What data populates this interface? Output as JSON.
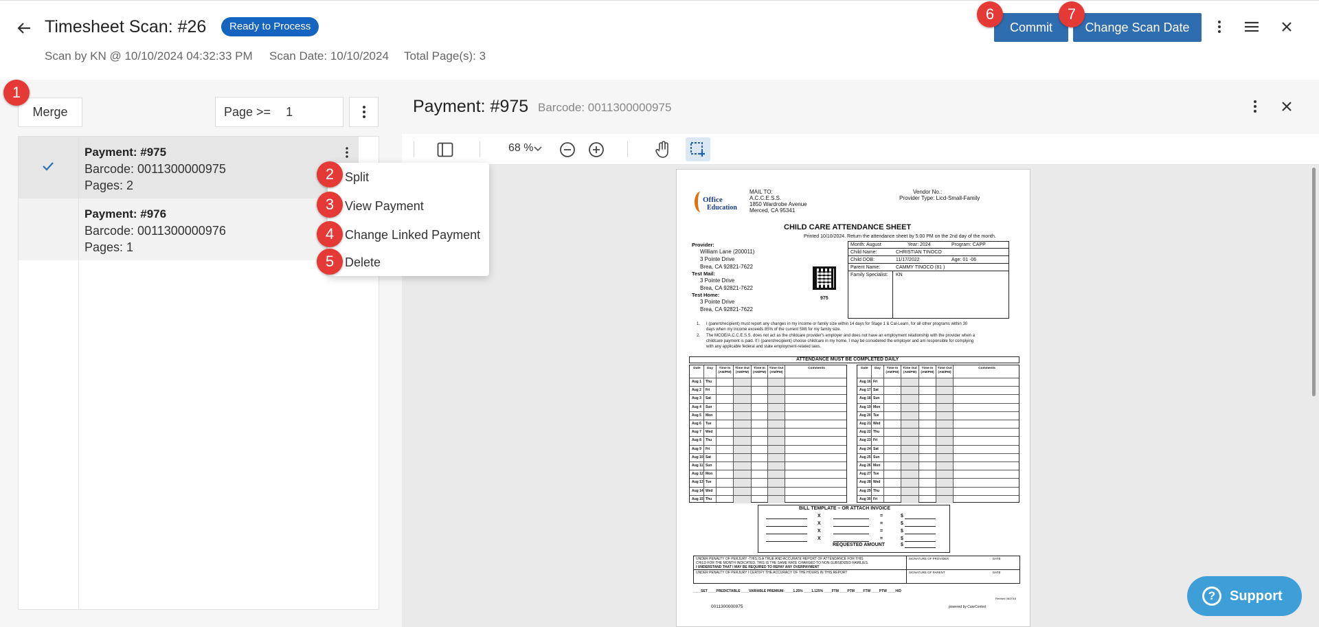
{
  "header": {
    "title": "Timesheet Scan: #26",
    "status": "Ready to Process",
    "scan_by": "Scan by KN @ 10/10/2024 04:32:33 PM",
    "scan_date": "Scan Date: 10/10/2024",
    "total_pages": "Total Page(s): 3",
    "commit_label": "Commit",
    "change_scan_date_label": "Change Scan Date"
  },
  "steps": [
    "1",
    "2",
    "3",
    "4",
    "5",
    "6",
    "7"
  ],
  "left": {
    "merge_label": "Merge",
    "filter_label": "Page >=",
    "filter_value": "1",
    "items": [
      {
        "title": "Payment: #975",
        "barcode": "Barcode: 0011300000975",
        "pages": "Pages: 2",
        "selected": true
      },
      {
        "title": "Payment: #976",
        "barcode": "Barcode: 0011300000976",
        "pages": "Pages: 1",
        "selected": false
      }
    ]
  },
  "context_menu": {
    "items": [
      "Split",
      "View Payment",
      "Change Linked Payment",
      "Delete"
    ]
  },
  "right": {
    "title": "Payment: #975",
    "barcode": "Barcode: 0011300000975",
    "zoom": "68 %"
  },
  "doc": {
    "mail_to": "MAIL TO:",
    "org": "A.C.C.E.S.S.",
    "addr1": "1850 Wardrobe Avenue",
    "addr2": "Merced, CA 95341",
    "vendor_no": "Vendor No.:",
    "provider_type": "Provider Type:  Licd-Small-Family",
    "logo_line1": "Office",
    "logo_line2": "Education",
    "sheet_title": "CHILD CARE ATTENDANCE SHEET",
    "printed": "Printed 10/10/2024. Return the attendance sheet by 5:00 PM on the 2nd day of the month.",
    "provider_lbl": "Provider:",
    "provider_name": "William Lane (200011)",
    "provider_addr1": "3 Pointe Drive",
    "provider_addr2": "Brea, CA 92821-7622",
    "test_mail_lbl": "Test Mail:",
    "test_mail_addr1": "3 Pointe Drive",
    "test_mail_addr2": "Brea, CA 92821-7622",
    "test_home_lbl": "Test Home:",
    "test_home_addr1": "3 Pointe Drive",
    "test_home_addr2": "Brea, CA 92821-7622",
    "qr_number": "975",
    "month": "Month: August",
    "year": "Year: 2024",
    "program": "Program: CAPP",
    "child_name_lbl": "Child Name:",
    "child_name": "CHRISTIAN  TINOCO",
    "child_dob_lbl": "Child DOB:",
    "child_dob": "11/17/2022",
    "age": "Age: 01 -06",
    "parent_lbl": "Parent Name:",
    "parent": "CAMMY  TINOCO (81 )",
    "specialist_lbl": "Family Specialist:",
    "specialist": "KN",
    "note1": "I (parent/recipient) must report any changes in my income or family size within 14 days for Stage 1 & Cal-Learn, for all other programs within 30",
    "note1b": "days when my income exceeds 85% of the current SMI for my family size.",
    "note2": "The MCOE/A.C.C.E.S.S. does not act as the childcare provider's employer and does not have an employment relationship with the provider when a",
    "note2b": "childcare payment is paid. If I (parent/recipient) choose childcare in my home, I may be considered the employer and am responsible for complying",
    "note2c": "with any applicable federal and state employment-related laws.",
    "attendance_header": "ATTENDANCE MUST BE COMPLETED DAILY",
    "col_headers": [
      "Date",
      "Day",
      "Time In (AM/PM)",
      "Time Out (AM/PM)",
      "Time In (AM/PM)",
      "Time Out (AM/PM)",
      "Comments"
    ],
    "left_rows": [
      [
        "Aug 1",
        "Thu"
      ],
      [
        "Aug 2",
        "Fri"
      ],
      [
        "Aug 3",
        "Sat"
      ],
      [
        "Aug 4",
        "Sun"
      ],
      [
        "Aug 5",
        "Mon"
      ],
      [
        "Aug 6",
        "Tue"
      ],
      [
        "Aug 7",
        "Wed"
      ],
      [
        "Aug 8",
        "Thu"
      ],
      [
        "Aug 9",
        "Fri"
      ],
      [
        "Aug 10",
        "Sat"
      ],
      [
        "Aug 11",
        "Sun"
      ],
      [
        "Aug 12",
        "Mon"
      ],
      [
        "Aug 13",
        "Tue"
      ],
      [
        "Aug 14",
        "Wed"
      ],
      [
        "Aug 15",
        "Thu"
      ]
    ],
    "right_rows": [
      [
        "Aug 16",
        "Fri"
      ],
      [
        "Aug 17",
        "Sat"
      ],
      [
        "Aug 18",
        "Sun"
      ],
      [
        "Aug 19",
        "Mon"
      ],
      [
        "Aug 20",
        "Tue"
      ],
      [
        "Aug 21",
        "Wed"
      ],
      [
        "Aug 22",
        "Thu"
      ],
      [
        "Aug 23",
        "Fri"
      ],
      [
        "Aug 24",
        "Sat"
      ],
      [
        "Aug 25",
        "Sun"
      ],
      [
        "Aug 26",
        "Mon"
      ],
      [
        "Aug 27",
        "Tue"
      ],
      [
        "Aug 28",
        "Wed"
      ],
      [
        "Aug 29",
        "Thu"
      ],
      [
        "Aug 30",
        "Fri"
      ]
    ],
    "bill_header": "BILL TEMPLATE – OR ATTACH INVOICE",
    "bill_x": "X",
    "bill_eq": "=",
    "bill_dollar": "$",
    "requested_amount": "REQUESTED AMOUNT",
    "perjury1": "UNDER PENALTY OF PERJURY -THIS IS A TRUE AND ACCURATE REPORT OF ATTENDANCE FOR THIS",
    "perjury2": "CHILD FOR THE MONTH INDICATED. THIS IS THE SAME RATE CHARGED TO NON-SUBSIDIZED FAMILIES.",
    "perjury3": "I UNDERSTAND THAT I MAY BE REQUIRED TO REPAY ANY OVERPAYMENT",
    "perjury4": "UNDER PENALTY OF PERJURY I CERTIFY THE ACCURACY OF THE HOURS IN THIS REPORT",
    "sig_provider": "SIGNATURE OF PROVIDER",
    "sig_parent": "SIGNATURE OF PARENT",
    "date_lbl": "DATE",
    "footer_opts": "____SET   ____PREDICTABLE   ____VARIABLE    PREMIUM:  ____1.25%   ____1.125%       ____FTM   ____PTM   ____FTW   ____PTW   ____H/D",
    "revised": "Revised 08/2018",
    "barcode_text": "0011300000975",
    "powered": "powered by CareControl"
  },
  "support_label": "Support",
  "colors": {
    "accent": "#2e6db0",
    "badge": "#1565c0",
    "step": "#e53935",
    "support": "#3e9fd8"
  }
}
